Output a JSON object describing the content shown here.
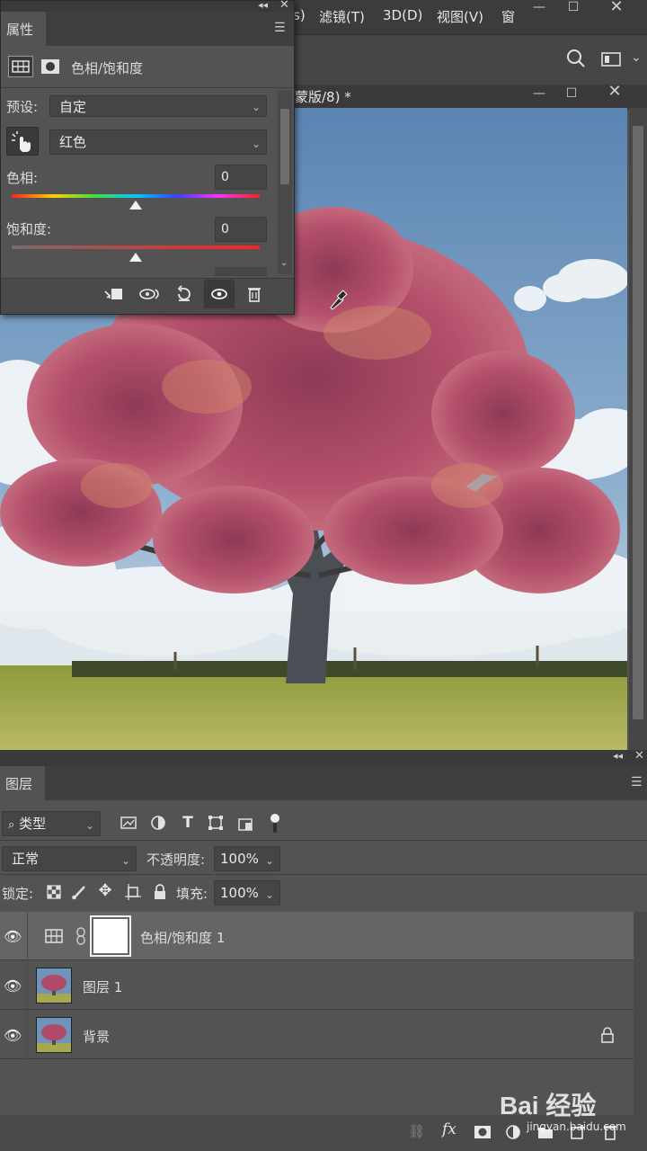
{
  "menubar": {
    "items": [
      {
        "label": "s)"
      },
      {
        "label": "滤镜(T)"
      },
      {
        "label": "3D(D)"
      },
      {
        "label": "视图(V)"
      },
      {
        "label": "窗"
      }
    ]
  },
  "document": {
    "tab_title": "蒙版/8) *"
  },
  "properties": {
    "tab_label": "属性",
    "adjustment_title": "色相/饱和度",
    "preset_label": "预设:",
    "preset_value": "自定",
    "channel_value": "红色",
    "hue_label": "色相:",
    "hue_value": "0",
    "saturation_label": "饱和度:",
    "saturation_value": "0",
    "hue_slider_fraction": 0.5,
    "saturation_slider_fraction": 0.5
  },
  "layers": {
    "tab_label": "图层",
    "filter_value": "类型",
    "blend_mode": "正常",
    "opacity_label": "不透明度:",
    "opacity_value": "100%",
    "lock_label": "锁定:",
    "fill_label": "填充:",
    "fill_value": "100%",
    "rows": [
      {
        "name": "色相/饱和度 1"
      },
      {
        "name": "图层 1"
      },
      {
        "name": "背景"
      }
    ]
  },
  "watermark": {
    "brand": "Bai 经验",
    "url": "jingyan.baidu.com"
  },
  "colors": {
    "panel_bg": "#535353",
    "panel_header": "#3f3f3f",
    "selected_row": "#656565",
    "sky": "#5f86b0",
    "foliage": "#b04a68",
    "grass": "#a4a850"
  }
}
